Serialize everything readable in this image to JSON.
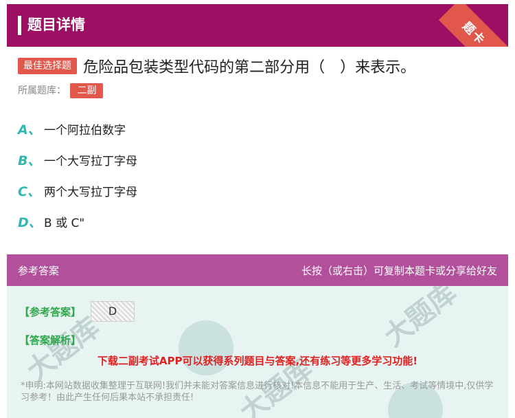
{
  "header": {
    "title": "题目详情",
    "corner_label": "题卡"
  },
  "question": {
    "tag": "最佳选择题",
    "text": "危险品包装类型代码的第二部分用（　）来表示。",
    "bank_label": "所属题库：",
    "bank_value": "二副"
  },
  "options": [
    {
      "letter": "A、",
      "text": "一个阿拉伯数字"
    },
    {
      "letter": "B、",
      "text": "一个大写拉丁字母"
    },
    {
      "letter": "C、",
      "text": "两个大写拉丁字母"
    },
    {
      "letter": "D、",
      "text": "B 或 C\""
    }
  ],
  "answer": {
    "title": "参考答案",
    "hint": "长按（或右击）可复制本题卡或分享给好友",
    "ref_label": "【参考答案】",
    "ref_value": "D",
    "analysis_label": "【答案解析】",
    "promo": "下载二副考试APP可以获得系列题目与答案,还有练习等更多学习功能!",
    "notice": "*申明:本网站数据收集整理于互联网!我们并未能对答案信息进行核对!本信息不能用于生产、生活、考试等情境中,仅供学习参考！由此产生任何后果本站不承担责任!"
  },
  "colors": {
    "header_bg": "#9c0f63",
    "answer_head_bg": "#b3509b",
    "accent_red": "#e2574c",
    "option_letter": "#2fb7b0",
    "answer_label": "#2ea84a",
    "promo_red": "#e02020"
  }
}
